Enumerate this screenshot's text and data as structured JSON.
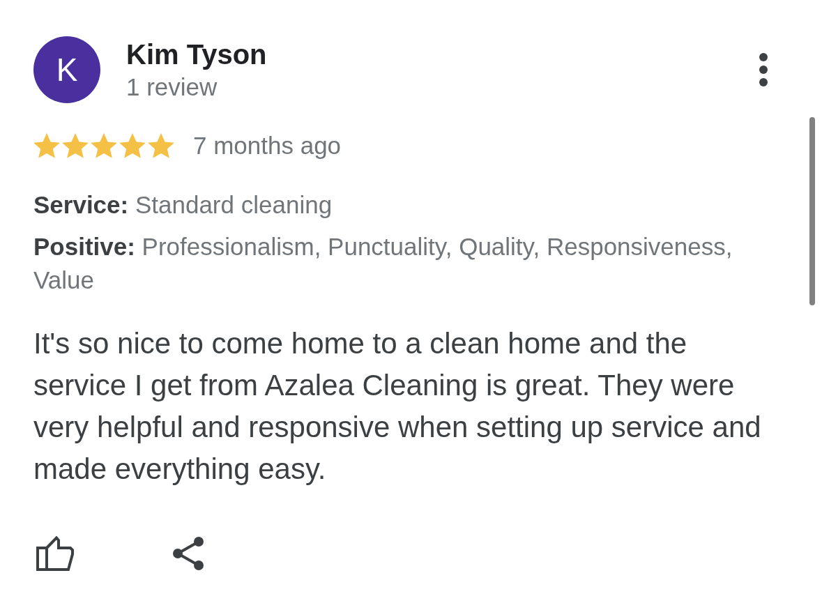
{
  "review": {
    "author": {
      "initial": "K",
      "name": "Kim Tyson",
      "review_count": "1 review"
    },
    "stars": 5,
    "time": "7 months ago",
    "attributes": [
      {
        "label": "Service:",
        "value": "Standard cleaning"
      },
      {
        "label": "Positive:",
        "value": "Professionalism, Punctuality, Quality, Responsiveness, Value"
      }
    ],
    "text": "It's so nice to come home to a clean home and the service I get from Azalea Cleaning is great. They were very helpful and responsive when setting up service and made everything easy."
  }
}
